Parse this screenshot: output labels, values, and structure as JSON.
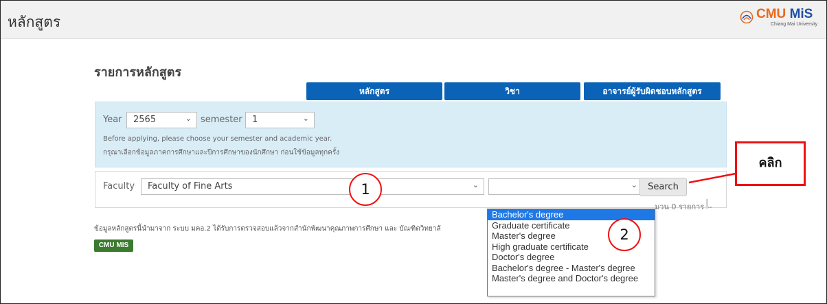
{
  "header": {
    "title": "หลักสูตร",
    "logo_text_cmu": "CMU",
    "logo_text_mis": "MiS",
    "logo_subtext": "Chiang Mai University"
  },
  "section_title": "รายการหลักสูตร",
  "tabs": [
    {
      "label": "หลักสูตร"
    },
    {
      "label": "วิชา"
    },
    {
      "label": "อาจารย์ผู้รับผิดชอบหลักสูตร"
    }
  ],
  "filters": {
    "year_label": "Year",
    "year_value": "2565",
    "semester_label": "semester",
    "semester_value": "1",
    "note_en": "Before applying, please choose your semester and academic year.",
    "note_th": "กรุณาเลือกข้อมูลภาคการศึกษาและปีการศึกษาของนักศึกษา ก่อนใช้ข้อมูลทุกครั้ง"
  },
  "search": {
    "faculty_label": "Faculty",
    "faculty_value": "Faculty of Fine Arts",
    "degree_value": "",
    "search_label": "Search",
    "count_text": "มวน 0 รายการ --"
  },
  "degree_options": [
    "Bachelor's degree",
    "Graduate certificate",
    "Master's degree",
    "High graduate certificate",
    "Doctor's degree",
    "Bachelor's degree - Master's degree",
    "Master's degree and Doctor's degree"
  ],
  "selected_option_index": 0,
  "source_note": "ข้อมูลหลักสูตรนี้นำมาจาก ระบบ มคอ.2 ได้รับการตรวจสอบแล้วจากสำนักพัฒนาคุณภาพการศึกษา และ บัณฑิตวิทยาลั",
  "badge": "CMU MIS",
  "annotations": {
    "marker_1": "1",
    "marker_2": "2",
    "callout": "คลิก"
  },
  "colors": {
    "tab_blue": "#0b63b8",
    "panel_blue": "#d9edf7",
    "highlight_red": "#e11111",
    "badge_green": "#3c7b2f",
    "selected_option": "#1e78e6"
  }
}
